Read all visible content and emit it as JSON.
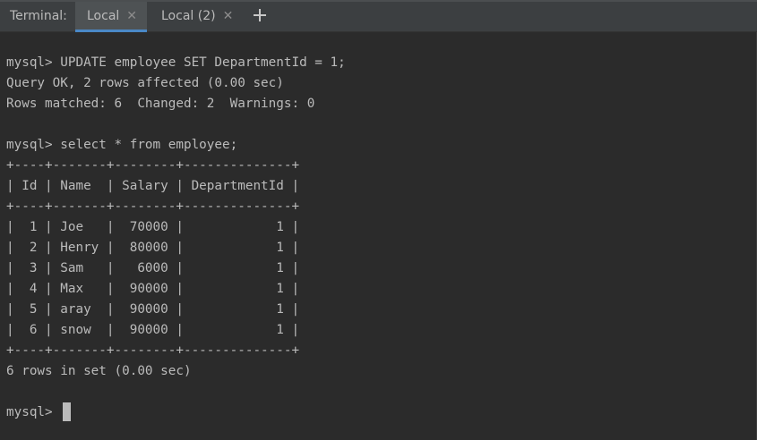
{
  "tabs": {
    "title": "Terminal:",
    "items": [
      {
        "label": "Local",
        "active": true
      },
      {
        "label": "Local (2)",
        "active": false
      }
    ],
    "add_icon": "plus-icon",
    "close_icon": "close-icon"
  },
  "terminal": {
    "lines": [
      "mysql> UPDATE employee SET DepartmentId = 1;",
      "Query OK, 2 rows affected (0.00 sec)",
      "Rows matched: 6  Changed: 2  Warnings: 0",
      "",
      "mysql> select * from employee;",
      "+----+-------+--------+--------------+",
      "| Id | Name  | Salary | DepartmentId |",
      "+----+-------+--------+--------------+",
      "|  1 | Joe   |  70000 |            1 |",
      "|  2 | Henry |  80000 |            1 |",
      "|  3 | Sam   |   6000 |            1 |",
      "|  4 | Max   |  90000 |            1 |",
      "|  5 | aray  |  90000 |            1 |",
      "|  6 | snow  |  90000 |            1 |",
      "+----+-------+--------+--------------+",
      "6 rows in set (0.00 sec)",
      "",
      "mysql> "
    ]
  },
  "colors": {
    "background": "#2b2b2b",
    "tabbar": "#3c3f41",
    "active_tab": "#4e5254",
    "active_underline": "#4a88c7",
    "text": "#bbbbbb"
  }
}
